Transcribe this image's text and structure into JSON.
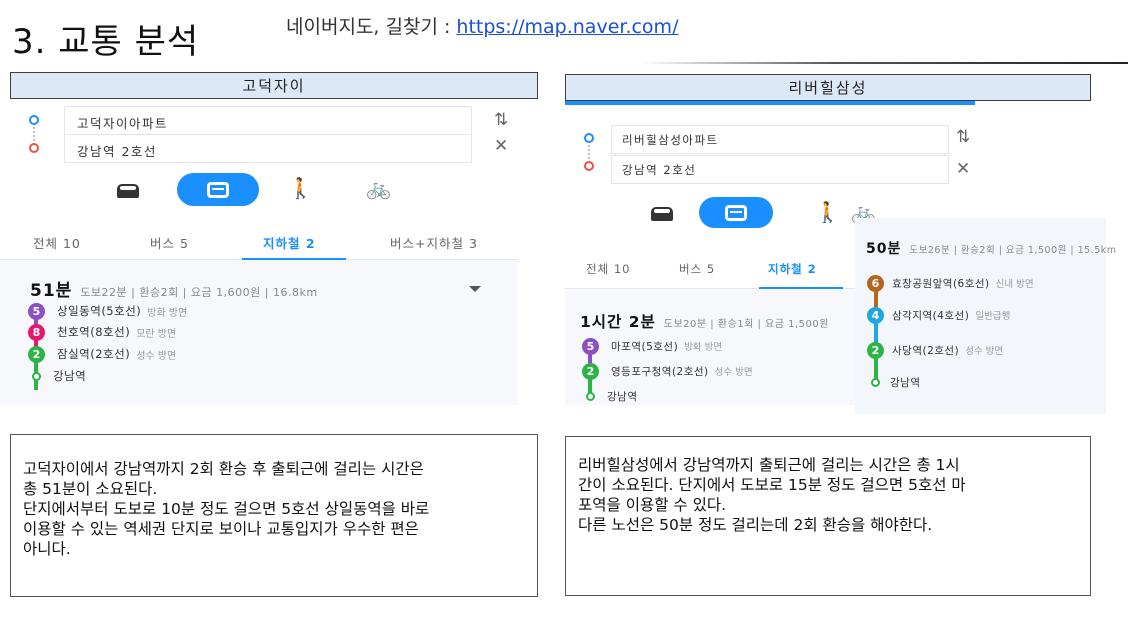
{
  "header": {
    "title": "3. 교통 분석",
    "note_prefix": "네이버지도, 길찾기 : ",
    "note_url": "https://map.naver.com/"
  },
  "colors": {
    "accent": "#1a8fff",
    "line5": "#8b50c4",
    "line8": "#e6186c",
    "line2": "#2db447",
    "line6": "#b5651d",
    "line4": "#20a7e0",
    "label_fill": "#dce8f6"
  },
  "left": {
    "label": "고덕자이",
    "start_stop": "고덕자이아파트",
    "end_stop": "강남역 2호선",
    "icons": {
      "swap": "swap-arrows-icon",
      "close": "close-icon",
      "car": "car-icon",
      "bus": "bus-icon",
      "walk": "walk-icon",
      "bike": "bike-icon"
    },
    "tabs": [
      "전체 10",
      "버스 5",
      "지하철 2",
      "버스+지하철 3"
    ],
    "active_tab": "지하철 2",
    "route": {
      "time": "51분",
      "detail": "도보22분 | 환승2회 | 요금 1,600원 | 16.8km",
      "steps": [
        {
          "line": "5",
          "station": "상일동역(5호선)",
          "direction": "방화 방면"
        },
        {
          "line": "8",
          "station": "천호역(8호선)",
          "direction": "모란 방면"
        },
        {
          "line": "2",
          "station": "잠실역(2호선)",
          "direction": "성수 방면"
        }
      ],
      "destination": "강남역"
    },
    "description": [
      "고덕자이에서 강남역까지 2회 환승 후 출퇴근에 걸리는 시간은",
      "총 51분이 소요된다.",
      "단지에서부터 도보로 10분 정도 걸으면 5호선 상일동역을 바로",
      "이용할 수 있는 역세권 단지로 보이나 교통입지가 우수한 편은",
      "아니다."
    ]
  },
  "right": {
    "label": "리버힐삼성",
    "start_stop": "리버힐삼성아파트",
    "end_stop": "강남역 2호선",
    "tabs": [
      "전체 10",
      "버스 5",
      "지하철 2"
    ],
    "active_tab": "지하철 2",
    "route": {
      "time": "1시간 2분",
      "detail": "도보20분 | 환승1회 | 요금 1,500원",
      "steps": [
        {
          "line": "5",
          "station": "마포역(5호선)",
          "direction": "방화 방면"
        },
        {
          "line": "2",
          "station": "영등포구청역(2호선)",
          "direction": "성수 방면"
        }
      ],
      "destination": "강남역"
    },
    "alt_route": {
      "time": "50분",
      "detail": "도보26분 | 환승2회 | 요금 1,500원 | 15.5km",
      "steps": [
        {
          "line": "6",
          "station": "효창공원앞역(6호선)",
          "direction": "신내 방면"
        },
        {
          "line": "4",
          "station": "삼각지역(4호선)",
          "direction": "일반급행"
        },
        {
          "line": "2",
          "station": "사당역(2호선)",
          "direction": "성수 방면"
        }
      ],
      "destination": "강남역"
    },
    "description": [
      "리버힐삼성에서 강남역까지 출퇴근에 걸리는 시간은 총 1시",
      "간이 소요된다. 단지에서 도보로 15분 정도 걸으면 5호선 마",
      "포역을 이용할 수 있다.",
      "다른 노선은 50분 정도 걸리는데 2회 환승을 해야한다."
    ]
  }
}
